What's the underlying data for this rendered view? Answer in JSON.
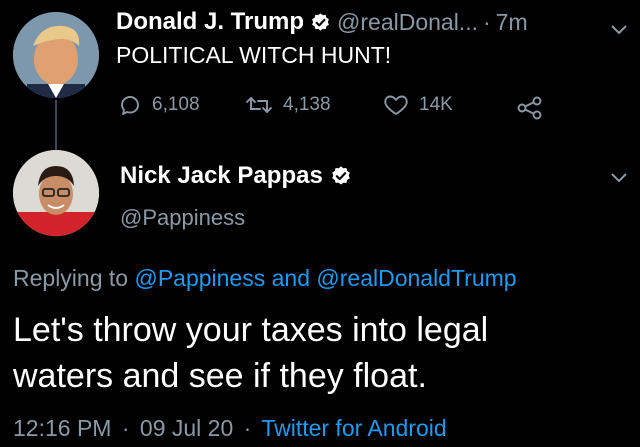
{
  "tweet1": {
    "author_name": "Donald J. Trump",
    "handle": "@realDonal...",
    "separator": "·",
    "time": "7m",
    "text": "POLITICAL WITCH HUNT!",
    "replies": "6,108",
    "retweets": "4,138",
    "likes": "14K"
  },
  "tweet2": {
    "author_name": "Nick Jack Pappas",
    "handle": "@Pappiness",
    "replying_prefix": "Replying to",
    "replying_user1": "@Pappiness",
    "replying_and": "and",
    "replying_user2": "@realDonaldTrump",
    "text_line1": "Let's throw your taxes into legal",
    "text_line2": "waters and see if they float.",
    "time": "12:16 PM",
    "dot1": "·",
    "date": "09 Jul 20",
    "dot2": "·",
    "source": "Twitter for Android"
  },
  "colors": {
    "background": "#000000",
    "secondary_text": "#8b98a5",
    "link": "#1d9bf0",
    "thread_line": "#3d4a55"
  },
  "icons": [
    "verified-badge-icon",
    "chevron-down-icon",
    "reply-icon",
    "retweet-icon",
    "like-icon",
    "share-icon"
  ]
}
